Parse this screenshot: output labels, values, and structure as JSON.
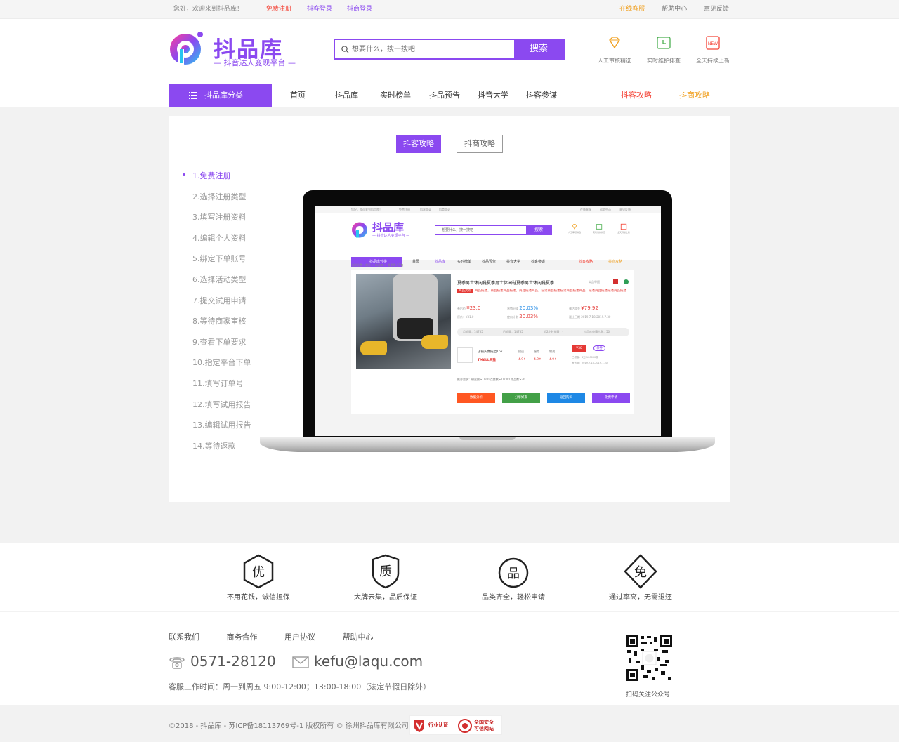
{
  "topbar": {
    "welcome": "您好，欢迎来到抖品库！",
    "register": "免费注册",
    "login_douyin": "抖客登录",
    "login_merchant": "抖商登录",
    "support": "在线客服",
    "help": "帮助中心",
    "feedback": "意见反馈"
  },
  "brand": {
    "name": "抖品库",
    "slogan": "— 抖音达人变现平台 —",
    "color": "#8b49f0"
  },
  "search": {
    "placeholder": "想要什么，搜一搜吧",
    "button": "搜索"
  },
  "header_features": [
    {
      "icon": "diamond-icon",
      "label": "人工审核精选"
    },
    {
      "icon": "clock-icon",
      "label": "实时维护排查"
    },
    {
      "icon": "new-tag-icon",
      "label": "全天持续上新"
    }
  ],
  "nav": {
    "category": "抖品库分类",
    "items": [
      "首页",
      "抖品库",
      "实时榜单",
      "抖品预告",
      "抖音大学",
      "抖客参谋"
    ],
    "guide_douyin": "抖客攻略",
    "guide_merchant": "抖商攻略"
  },
  "tabs": {
    "active": "抖客攻略",
    "inactive": "抖商攻略"
  },
  "steps": [
    "1.免费注册",
    "2.选择注册类型",
    "3.填写注册资料",
    "4.编辑个人资料",
    "5.绑定下单账号",
    "6.选择活动类型",
    "7.提交试用申请",
    "8.等待商家审核",
    "9.查看下单要求",
    "10.指定平台下单",
    "11.填写订单号",
    "12.填写试用报告",
    "13.编辑试用报告",
    "14.等待返款"
  ],
  "preview": {
    "top_left": "您好，欢迎来到抖品库！",
    "register": "免费注册",
    "login_douyin": "抖客登录",
    "login_merchant": "抖商登录",
    "top_right": [
      "在线客服",
      "帮助中心",
      "意见反馈"
    ],
    "brand": "抖品库",
    "slogan": "— 抖音达人变现平台 —",
    "search_placeholder": "想要什么，搜一搜吧",
    "search_button": "搜索",
    "features": [
      "人工审核精选",
      "实时维护排查",
      "全天持续上新"
    ],
    "category": "抖品库分类",
    "nav": [
      "首页",
      "抖品库",
      "实时榜单",
      "抖品预告",
      "抖音大学",
      "抖客参谋"
    ],
    "guide_douyin": "抖客攻略",
    "guide_merchant": "抖商攻略",
    "breadcrumb": "当前位置：首页 > 抖品库 > 夏季男士T恤",
    "product_title": "夏季男士休闲鞋夏季男士休闲鞋夏季男士休闲鞋夏季",
    "report_link": "商品举报",
    "tag": "商品卖点",
    "description": "商品描述，商品描述商品描述，商品描述商品，描述商品描述描述商品描述商品，描述商品描述描述商品描述",
    "price_label": "券后价",
    "price": "¥23.0",
    "original_price_label": "原价：",
    "original_price": "¥31.0",
    "commission_label": "营销分成",
    "commission": "20.03%",
    "direct_commission_label": "定向计划",
    "direct_commission": "20.03%",
    "expected_label": "预估佣金",
    "expected": "¥79.92",
    "period_label": "截止日期",
    "period": "2019.7.18-2019.7.30",
    "stats": [
      "月销量：14785",
      "日销量：14785",
      "近2小时销量：-",
      "抖品库申请人数：50"
    ],
    "shop_name": "店铺头像描边1px",
    "shop_platform": "TMALL天猫",
    "score_labels": [
      "描述",
      "服务",
      "物流"
    ],
    "scores": [
      "4.9↑",
      "4.9↑",
      "4.9↑"
    ],
    "coupon": "¥30",
    "coupon_action": "领券",
    "coupon_claimed": "已领取：8万/100000张",
    "coupon_validity": "有效期：2019.7.18-2019.7.30",
    "requirements": "推荐要求：粉丝数≥1000  点赞数≥10000  作品数≥20",
    "buttons": [
      "数据分析",
      "分享好友",
      "返回购买",
      "免费申请"
    ]
  },
  "benefits": [
    {
      "glyph": "优",
      "label": "不用花钱，诚信担保"
    },
    {
      "glyph": "质",
      "label": "大牌云集，品质保证"
    },
    {
      "glyph": "品",
      "label": "品类齐全，轻松申请"
    },
    {
      "glyph": "免",
      "label": "通过率高，无需退还"
    }
  ],
  "footer": {
    "links": [
      "联系我们",
      "商务合作",
      "用户协议",
      "帮助中心"
    ],
    "phone": "0571-28120",
    "email": "kefu@laqu.com",
    "hours": "客服工作时间：周一到周五 9:00-12:00；13:00-18:00（法定节假日除外）",
    "qr_label": "扫码关注公众号",
    "copyright": "©2018 - 抖品库 - 苏ICP备18113769号-1 版权所有 © 徐州抖品库有限公司",
    "cert1": "行业认证",
    "cert2a": "全国安全",
    "cert2b": "可信网站"
  }
}
